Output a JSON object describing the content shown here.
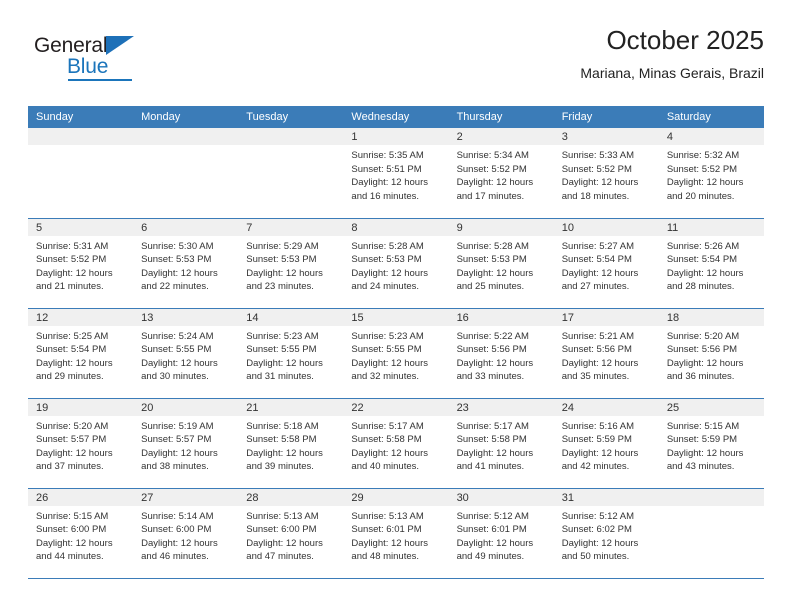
{
  "logo": {
    "word_one": "General",
    "word_two": "Blue",
    "triangle_icon": "blue-triangle-icon"
  },
  "header": {
    "title": "October 2025",
    "subtitle": "Mariana, Minas Gerais, Brazil"
  },
  "colors": {
    "header_blue": "#3b7cb8",
    "logo_blue": "#1b75bb",
    "daynum_bg": "#f0f0f0",
    "text": "#333333"
  },
  "calendar": {
    "weekdays": [
      "Sunday",
      "Monday",
      "Tuesday",
      "Wednesday",
      "Thursday",
      "Friday",
      "Saturday"
    ],
    "weeks": [
      [
        {
          "day": "",
          "sunrise": "",
          "sunset": "",
          "daylight1": "",
          "daylight2": ""
        },
        {
          "day": "",
          "sunrise": "",
          "sunset": "",
          "daylight1": "",
          "daylight2": ""
        },
        {
          "day": "",
          "sunrise": "",
          "sunset": "",
          "daylight1": "",
          "daylight2": ""
        },
        {
          "day": "1",
          "sunrise": "Sunrise: 5:35 AM",
          "sunset": "Sunset: 5:51 PM",
          "daylight1": "Daylight: 12 hours",
          "daylight2": "and 16 minutes."
        },
        {
          "day": "2",
          "sunrise": "Sunrise: 5:34 AM",
          "sunset": "Sunset: 5:52 PM",
          "daylight1": "Daylight: 12 hours",
          "daylight2": "and 17 minutes."
        },
        {
          "day": "3",
          "sunrise": "Sunrise: 5:33 AM",
          "sunset": "Sunset: 5:52 PM",
          "daylight1": "Daylight: 12 hours",
          "daylight2": "and 18 minutes."
        },
        {
          "day": "4",
          "sunrise": "Sunrise: 5:32 AM",
          "sunset": "Sunset: 5:52 PM",
          "daylight1": "Daylight: 12 hours",
          "daylight2": "and 20 minutes."
        }
      ],
      [
        {
          "day": "5",
          "sunrise": "Sunrise: 5:31 AM",
          "sunset": "Sunset: 5:52 PM",
          "daylight1": "Daylight: 12 hours",
          "daylight2": "and 21 minutes."
        },
        {
          "day": "6",
          "sunrise": "Sunrise: 5:30 AM",
          "sunset": "Sunset: 5:53 PM",
          "daylight1": "Daylight: 12 hours",
          "daylight2": "and 22 minutes."
        },
        {
          "day": "7",
          "sunrise": "Sunrise: 5:29 AM",
          "sunset": "Sunset: 5:53 PM",
          "daylight1": "Daylight: 12 hours",
          "daylight2": "and 23 minutes."
        },
        {
          "day": "8",
          "sunrise": "Sunrise: 5:28 AM",
          "sunset": "Sunset: 5:53 PM",
          "daylight1": "Daylight: 12 hours",
          "daylight2": "and 24 minutes."
        },
        {
          "day": "9",
          "sunrise": "Sunrise: 5:28 AM",
          "sunset": "Sunset: 5:53 PM",
          "daylight1": "Daylight: 12 hours",
          "daylight2": "and 25 minutes."
        },
        {
          "day": "10",
          "sunrise": "Sunrise: 5:27 AM",
          "sunset": "Sunset: 5:54 PM",
          "daylight1": "Daylight: 12 hours",
          "daylight2": "and 27 minutes."
        },
        {
          "day": "11",
          "sunrise": "Sunrise: 5:26 AM",
          "sunset": "Sunset: 5:54 PM",
          "daylight1": "Daylight: 12 hours",
          "daylight2": "and 28 minutes."
        }
      ],
      [
        {
          "day": "12",
          "sunrise": "Sunrise: 5:25 AM",
          "sunset": "Sunset: 5:54 PM",
          "daylight1": "Daylight: 12 hours",
          "daylight2": "and 29 minutes."
        },
        {
          "day": "13",
          "sunrise": "Sunrise: 5:24 AM",
          "sunset": "Sunset: 5:55 PM",
          "daylight1": "Daylight: 12 hours",
          "daylight2": "and 30 minutes."
        },
        {
          "day": "14",
          "sunrise": "Sunrise: 5:23 AM",
          "sunset": "Sunset: 5:55 PM",
          "daylight1": "Daylight: 12 hours",
          "daylight2": "and 31 minutes."
        },
        {
          "day": "15",
          "sunrise": "Sunrise: 5:23 AM",
          "sunset": "Sunset: 5:55 PM",
          "daylight1": "Daylight: 12 hours",
          "daylight2": "and 32 minutes."
        },
        {
          "day": "16",
          "sunrise": "Sunrise: 5:22 AM",
          "sunset": "Sunset: 5:56 PM",
          "daylight1": "Daylight: 12 hours",
          "daylight2": "and 33 minutes."
        },
        {
          "day": "17",
          "sunrise": "Sunrise: 5:21 AM",
          "sunset": "Sunset: 5:56 PM",
          "daylight1": "Daylight: 12 hours",
          "daylight2": "and 35 minutes."
        },
        {
          "day": "18",
          "sunrise": "Sunrise: 5:20 AM",
          "sunset": "Sunset: 5:56 PM",
          "daylight1": "Daylight: 12 hours",
          "daylight2": "and 36 minutes."
        }
      ],
      [
        {
          "day": "19",
          "sunrise": "Sunrise: 5:20 AM",
          "sunset": "Sunset: 5:57 PM",
          "daylight1": "Daylight: 12 hours",
          "daylight2": "and 37 minutes."
        },
        {
          "day": "20",
          "sunrise": "Sunrise: 5:19 AM",
          "sunset": "Sunset: 5:57 PM",
          "daylight1": "Daylight: 12 hours",
          "daylight2": "and 38 minutes."
        },
        {
          "day": "21",
          "sunrise": "Sunrise: 5:18 AM",
          "sunset": "Sunset: 5:58 PM",
          "daylight1": "Daylight: 12 hours",
          "daylight2": "and 39 minutes."
        },
        {
          "day": "22",
          "sunrise": "Sunrise: 5:17 AM",
          "sunset": "Sunset: 5:58 PM",
          "daylight1": "Daylight: 12 hours",
          "daylight2": "and 40 minutes."
        },
        {
          "day": "23",
          "sunrise": "Sunrise: 5:17 AM",
          "sunset": "Sunset: 5:58 PM",
          "daylight1": "Daylight: 12 hours",
          "daylight2": "and 41 minutes."
        },
        {
          "day": "24",
          "sunrise": "Sunrise: 5:16 AM",
          "sunset": "Sunset: 5:59 PM",
          "daylight1": "Daylight: 12 hours",
          "daylight2": "and 42 minutes."
        },
        {
          "day": "25",
          "sunrise": "Sunrise: 5:15 AM",
          "sunset": "Sunset: 5:59 PM",
          "daylight1": "Daylight: 12 hours",
          "daylight2": "and 43 minutes."
        }
      ],
      [
        {
          "day": "26",
          "sunrise": "Sunrise: 5:15 AM",
          "sunset": "Sunset: 6:00 PM",
          "daylight1": "Daylight: 12 hours",
          "daylight2": "and 44 minutes."
        },
        {
          "day": "27",
          "sunrise": "Sunrise: 5:14 AM",
          "sunset": "Sunset: 6:00 PM",
          "daylight1": "Daylight: 12 hours",
          "daylight2": "and 46 minutes."
        },
        {
          "day": "28",
          "sunrise": "Sunrise: 5:13 AM",
          "sunset": "Sunset: 6:00 PM",
          "daylight1": "Daylight: 12 hours",
          "daylight2": "and 47 minutes."
        },
        {
          "day": "29",
          "sunrise": "Sunrise: 5:13 AM",
          "sunset": "Sunset: 6:01 PM",
          "daylight1": "Daylight: 12 hours",
          "daylight2": "and 48 minutes."
        },
        {
          "day": "30",
          "sunrise": "Sunrise: 5:12 AM",
          "sunset": "Sunset: 6:01 PM",
          "daylight1": "Daylight: 12 hours",
          "daylight2": "and 49 minutes."
        },
        {
          "day": "31",
          "sunrise": "Sunrise: 5:12 AM",
          "sunset": "Sunset: 6:02 PM",
          "daylight1": "Daylight: 12 hours",
          "daylight2": "and 50 minutes."
        },
        {
          "day": "",
          "sunrise": "",
          "sunset": "",
          "daylight1": "",
          "daylight2": ""
        }
      ]
    ]
  }
}
